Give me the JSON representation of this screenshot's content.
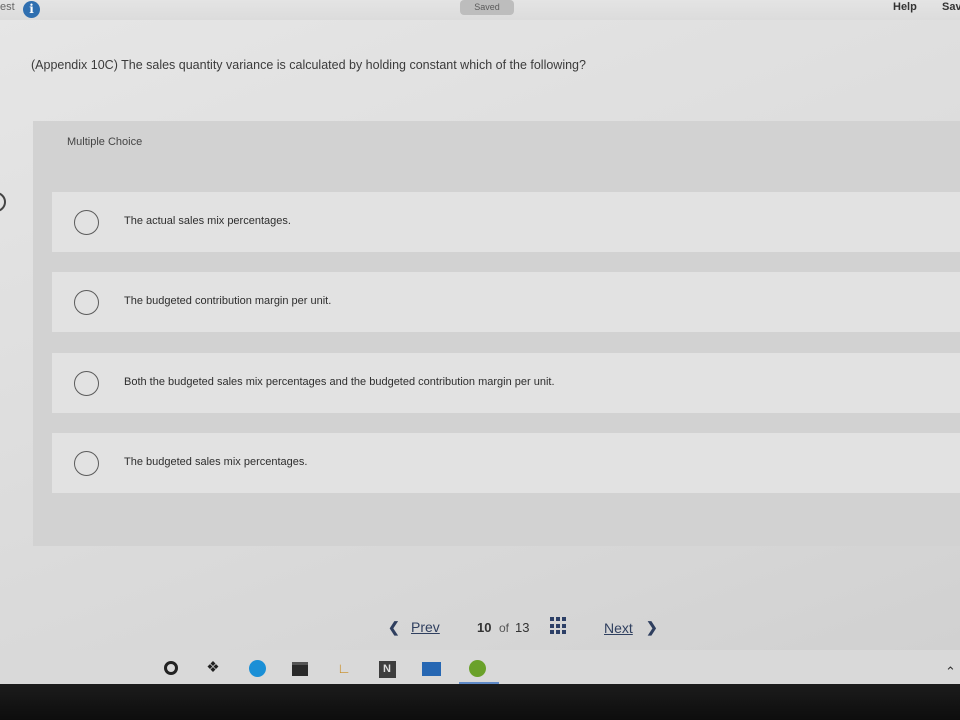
{
  "header": {
    "test_label": "est",
    "saved_label": "Saved",
    "help_label": "Help",
    "save_exit_label": "Sav"
  },
  "question": {
    "text": "(Appendix 10C) The sales quantity variance is calculated by holding constant which of the following?",
    "type_label": "Multiple Choice"
  },
  "options": [
    {
      "label": "The actual sales mix percentages."
    },
    {
      "label": "The budgeted contribution margin per unit."
    },
    {
      "label": "Both the budgeted sales mix percentages and the budgeted contribution margin per unit."
    },
    {
      "label": "The budgeted sales mix percentages."
    }
  ],
  "navigation": {
    "prev_label": "Prev",
    "current_page": "10",
    "of_label": "of",
    "total_pages": "13",
    "next_label": "Next"
  },
  "taskbar": {
    "icons": [
      "cortana-icon",
      "dropbox-icon",
      "edge-icon",
      "store-icon",
      "app-icon",
      "onenote-icon",
      "mail-icon",
      "browser-icon"
    ]
  },
  "colors": {
    "info_icon": "#2f6fb0",
    "nav_text": "#2f3f5f",
    "option_bg": "#e2e2e2",
    "panel_bg": "#d2d2d2"
  }
}
